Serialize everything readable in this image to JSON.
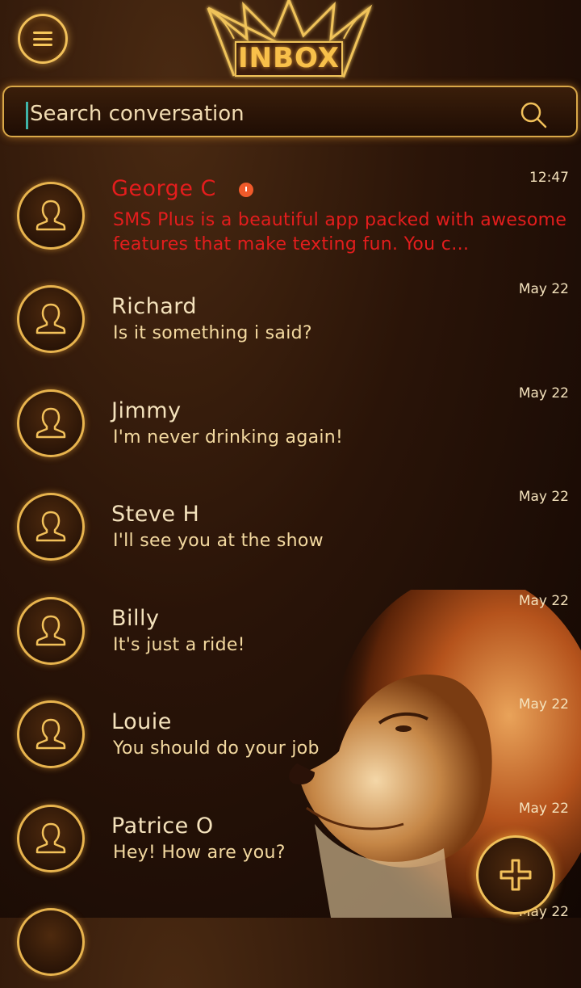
{
  "header": {
    "title": "INBOX",
    "menu_icon": "hamburger-menu-icon",
    "crown_icon": "crown-icon"
  },
  "search": {
    "placeholder": "Search conversation",
    "icon": "search-icon"
  },
  "conversations": [
    {
      "name": "George C",
      "message": "SMS Plus is a beautiful app packed with awesome features that make texting fun. You c…",
      "time": "12:47",
      "unread": true
    },
    {
      "name": "Richard",
      "message": "Is it something i said?",
      "time": "May 22",
      "unread": false
    },
    {
      "name": "Jimmy",
      "message": "I'm never drinking again!",
      "time": "May 22",
      "unread": false
    },
    {
      "name": "Steve H",
      "message": "I'll see you at the show",
      "time": "May 22",
      "unread": false
    },
    {
      "name": "Billy",
      "message": "It's just a ride!",
      "time": "May 22",
      "unread": false
    },
    {
      "name": "Louie",
      "message": "You should do your job",
      "time": "May 22",
      "unread": false
    },
    {
      "name": "Patrice O",
      "message": "Hey! How are you?",
      "time": "May 22",
      "unread": false
    },
    {
      "name": "",
      "message": "",
      "time": "May 22",
      "unread": false
    }
  ],
  "fab": {
    "icon": "plus-icon"
  },
  "colors": {
    "accent_gold": "#f2c15a",
    "unread_red": "#e41d1d",
    "background": "#2a1408"
  }
}
